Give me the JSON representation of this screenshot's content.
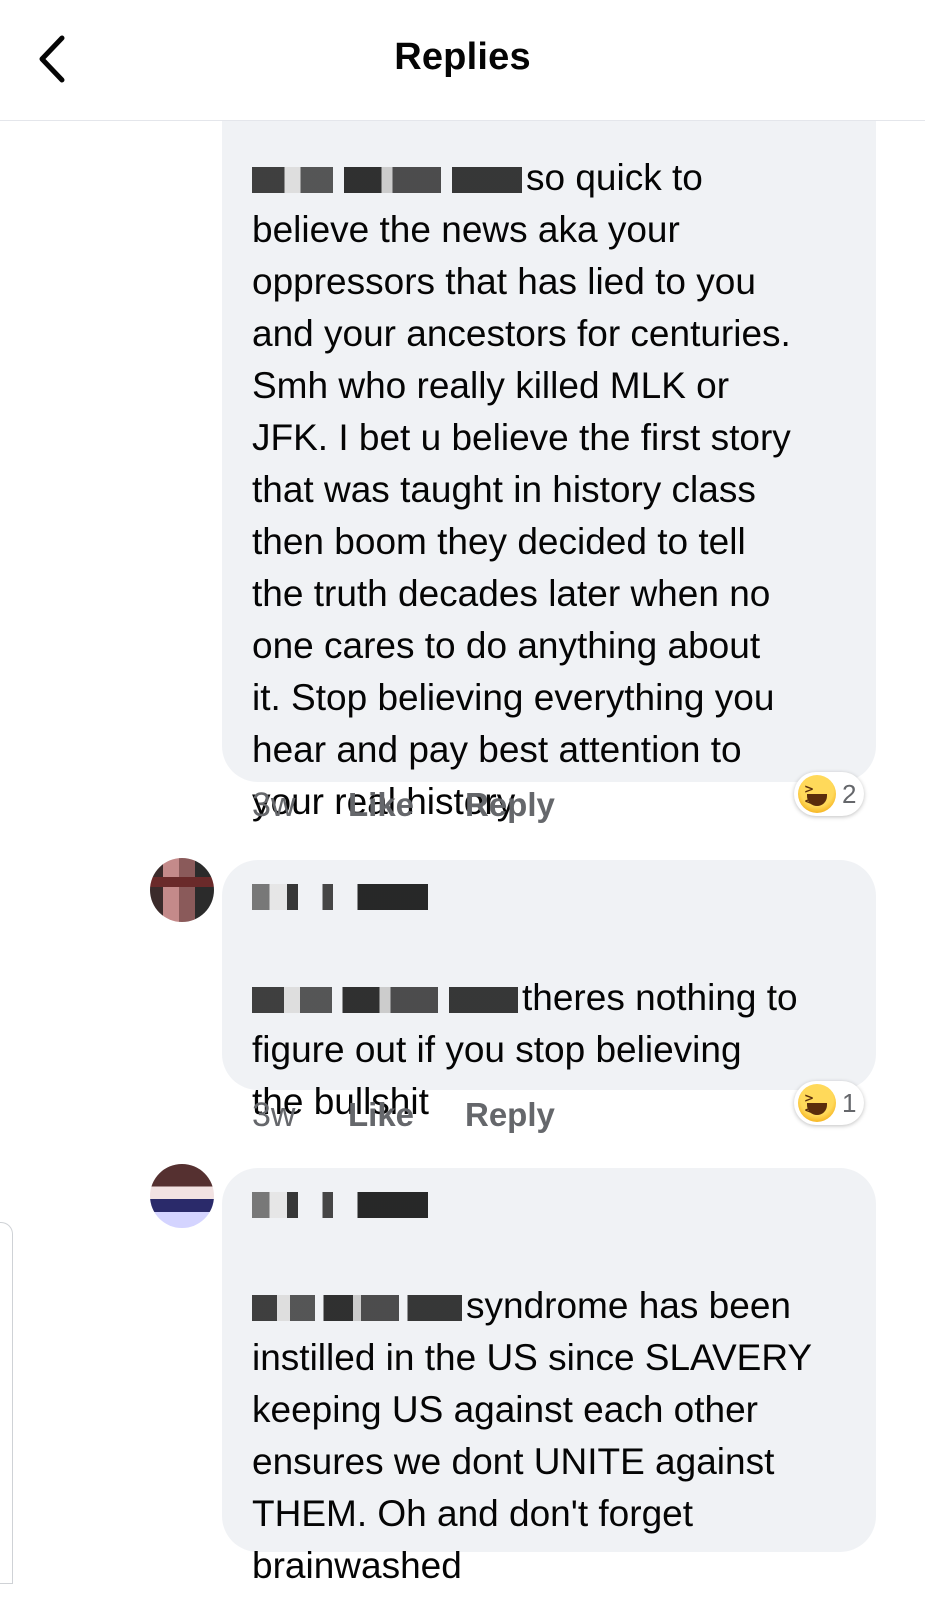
{
  "header": {
    "title": "Replies",
    "back_icon": "chevron-left-icon"
  },
  "comments": [
    {
      "author_redacted": true,
      "text_prefix": "so quick to",
      "text": "believe the news aka your\noppressors that has lied to you\nand your ancestors for centuries.\nSmh who really killed MLK or\nJFK. I bet u believe the first story\nthat was taught in history class\nthen boom they decided to tell\nthe truth decades later when no\none cares to do anything about\nit. Stop believing everything you\nhear and pay best attention to\nyour real history",
      "time": "3w",
      "like": "Like",
      "reply": "Reply",
      "reaction": {
        "icon": "laughing-emoji-icon",
        "count": "2"
      }
    },
    {
      "author_redacted": true,
      "text_prefix": "theres nothing to",
      "text": "figure out if you stop believing\nthe bullshit",
      "time": "3w",
      "like": "Like",
      "reply": "Reply",
      "reaction": {
        "icon": "laughing-emoji-icon",
        "count": "1"
      }
    },
    {
      "author_redacted": true,
      "text_prefix": "syndrome has been",
      "text": "instilled in the US since SLAVERY\nkeeping US against each other\nensures we dont UNITE against\nTHEM. Oh and don't forget\nbrainwashed"
    }
  ],
  "colors": {
    "bubble": "#f0f2f5",
    "meta_text": "#65676b",
    "text": "#050505"
  }
}
